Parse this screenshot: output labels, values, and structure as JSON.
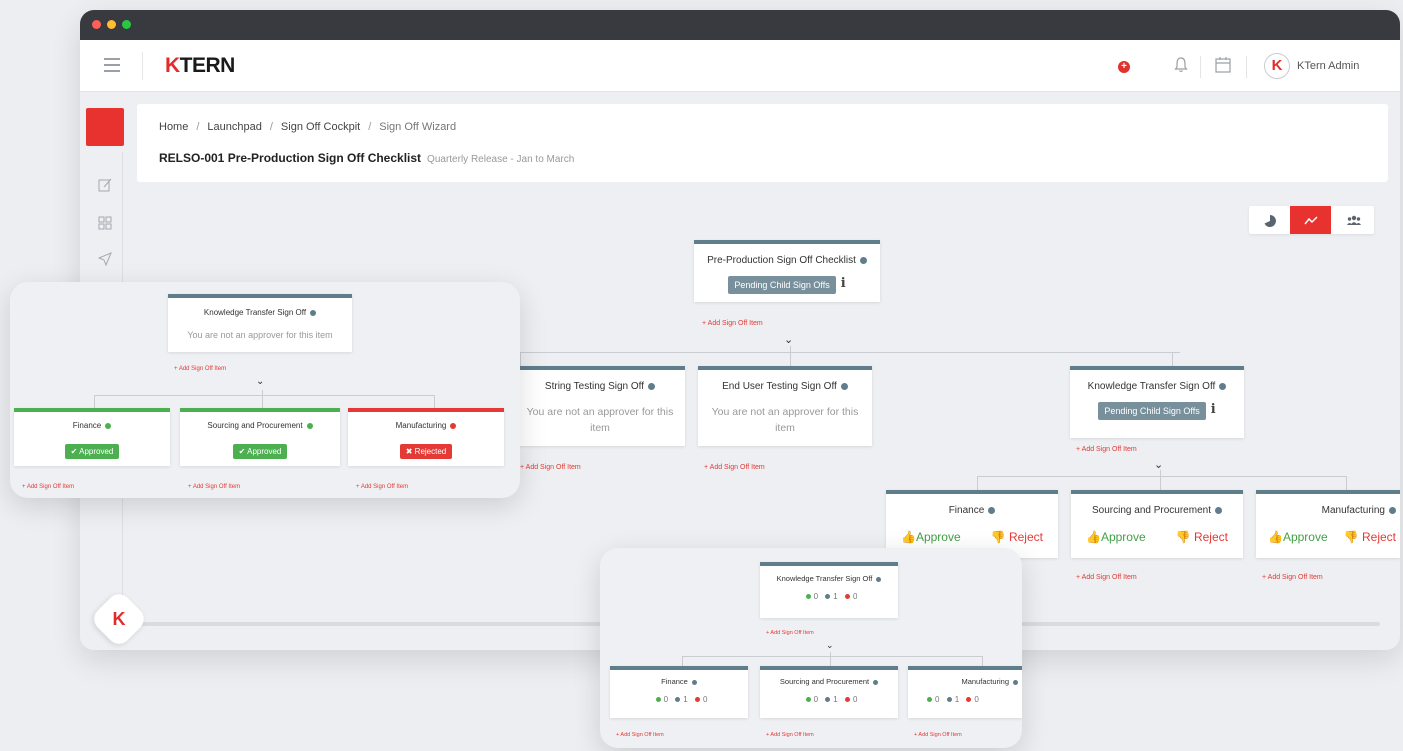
{
  "app": {
    "logo_prefix": "K",
    "logo_rest": "TERN",
    "user_name": "KTern Admin",
    "avatar_letter": "K"
  },
  "breadcrumb": [
    "Home",
    "Launchpad",
    "Sign Off Cockpit",
    "Sign Off Wizard"
  ],
  "page": {
    "title": "RELSO-001 Pre-Production Sign Off Checklist",
    "subtitle": "Quarterly Release - Jan to March"
  },
  "common": {
    "add_item": "+ Add Sign Off Item",
    "not_approver": "You are not an approver for this item",
    "pending": "Pending Child Sign Offs",
    "approve": "Approve",
    "reject": "Reject",
    "approved": "Approved",
    "rejected": "Rejected"
  },
  "tree": {
    "root": "Pre-Production Sign Off Checklist",
    "children": [
      "String Testing Sign Off",
      "End User Testing Sign Off",
      "Knowledge Transfer Sign Off"
    ],
    "grandchildren": [
      "Finance",
      "Sourcing and Procurement",
      "Manufacturing"
    ]
  },
  "panel1": {
    "root": "Knowledge Transfer Sign Off",
    "children": [
      "Finance",
      "Sourcing and Procurement",
      "Manufacturing"
    ]
  },
  "panel2": {
    "root": "Knowledge Transfer Sign Off",
    "root_counts": [
      "0",
      "1",
      "0"
    ],
    "children": [
      "Finance",
      "Sourcing and Procurement",
      "Manufacturing"
    ],
    "child_counts": [
      "0",
      "1",
      "0"
    ]
  },
  "colors": {
    "accent": "#e8322f",
    "approved": "#4caf50",
    "rejected": "#e53935",
    "neutral": "#607d8b"
  }
}
